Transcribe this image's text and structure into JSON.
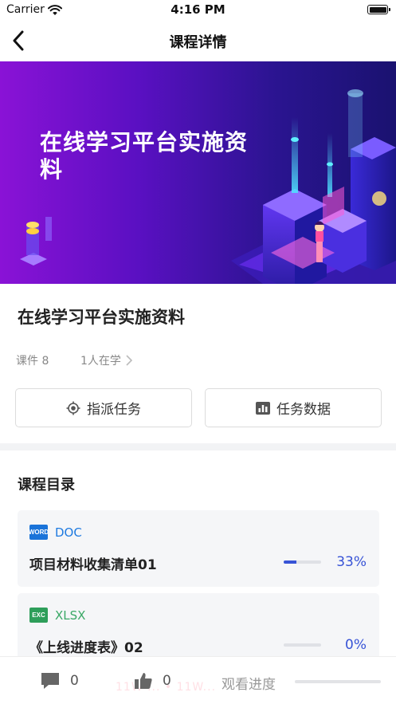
{
  "status_bar": {
    "carrier": "Carrier",
    "time": "4:16 PM"
  },
  "nav": {
    "title": "课程详情"
  },
  "banner": {
    "title": "在线学习平台实施资料"
  },
  "course": {
    "title": "在线学习平台实施资料",
    "lesson_count": "课件 8",
    "learners": "1人在学"
  },
  "actions": {
    "assign_label": "指派任务",
    "stats_label": "任务数据"
  },
  "catalog": {
    "title": "课程目录",
    "files": [
      {
        "type_icon": "WORD",
        "type_label": "DOC",
        "name": "项目材料收集清单01",
        "progress": 0.33,
        "progress_text": "33%"
      },
      {
        "type_icon": "EXC",
        "type_label": "XLSX",
        "name": "《上线进度表》02",
        "progress": 0,
        "progress_text": "0%"
      }
    ]
  },
  "bottom": {
    "comment_count": "0",
    "like_count": "0",
    "watch_label": "观看进度",
    "watermark": "11W ... • 11W..."
  },
  "colors": {
    "accent": "#3753d6",
    "doc": "#1a73d9",
    "xlsx": "#2e9e5a",
    "banner_start": "#8a12d6",
    "banner_end": "#1a1270"
  }
}
